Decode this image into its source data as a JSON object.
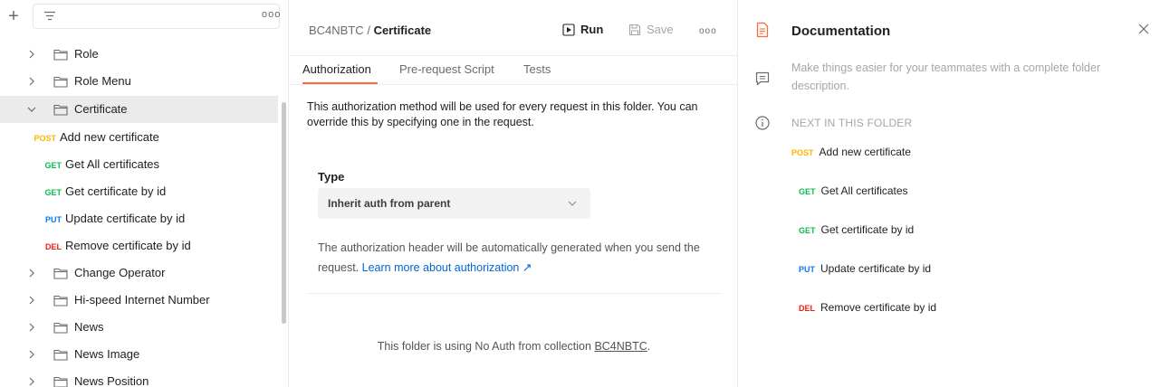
{
  "colors": {
    "post": "#ffb400",
    "get": "#0cbb52",
    "put": "#097bed",
    "del": "#eb2013",
    "accent": "#ff6c37",
    "link": "#0265d2"
  },
  "sidebar": {
    "add_icon": "plus-icon",
    "filter_placeholder": "",
    "more_icon": "more-icon",
    "folders_top": [
      {
        "label": "Role"
      },
      {
        "label": "Role Menu"
      }
    ],
    "selected_folder": {
      "label": "Certificate"
    },
    "requests": [
      {
        "method": "POST",
        "label": "Add new certificate"
      },
      {
        "method": "GET",
        "label": "Get All certificates"
      },
      {
        "method": "GET",
        "label": "Get certificate by id"
      },
      {
        "method": "PUT",
        "label": "Update certificate by id"
      },
      {
        "method": "DEL",
        "label": "Remove certificate by id"
      }
    ],
    "folders_bottom": [
      {
        "label": "Change Operator"
      },
      {
        "label": "Hi-speed Internet Number"
      },
      {
        "label": "News"
      },
      {
        "label": "News Image"
      },
      {
        "label": "News Position"
      }
    ]
  },
  "header": {
    "collection": "BC4NBTC",
    "separator": "/",
    "folder": "Certificate",
    "run_label": "Run",
    "save_label": "Save"
  },
  "tabs": [
    {
      "label": "Authorization",
      "active": true
    },
    {
      "label": "Pre-request Script",
      "active": false
    },
    {
      "label": "Tests",
      "active": false
    }
  ],
  "auth": {
    "description": "This authorization method will be used for every request in this folder. You can override this by specifying one in the request.",
    "type_label": "Type",
    "type_value": "Inherit auth from parent",
    "note_prefix": "The authorization header will be automatically generated when you send the request.",
    "note_link": "Learn more about authorization ↗",
    "collection_note_prefix": "This folder is using No Auth from collection",
    "collection_note_link": "BC4NBTC",
    "collection_note_suffix": "."
  },
  "docs": {
    "title": "Documentation",
    "description": "Make things easier for your teammates with a complete folder description.",
    "next_title": "NEXT IN THIS FOLDER",
    "items": [
      {
        "method": "POST",
        "label": "Add new certificate"
      },
      {
        "method": "GET",
        "label": "Get All certificates"
      },
      {
        "method": "GET",
        "label": "Get certificate by id"
      },
      {
        "method": "PUT",
        "label": "Update certificate by id"
      },
      {
        "method": "DEL",
        "label": "Remove certificate by id"
      }
    ]
  }
}
